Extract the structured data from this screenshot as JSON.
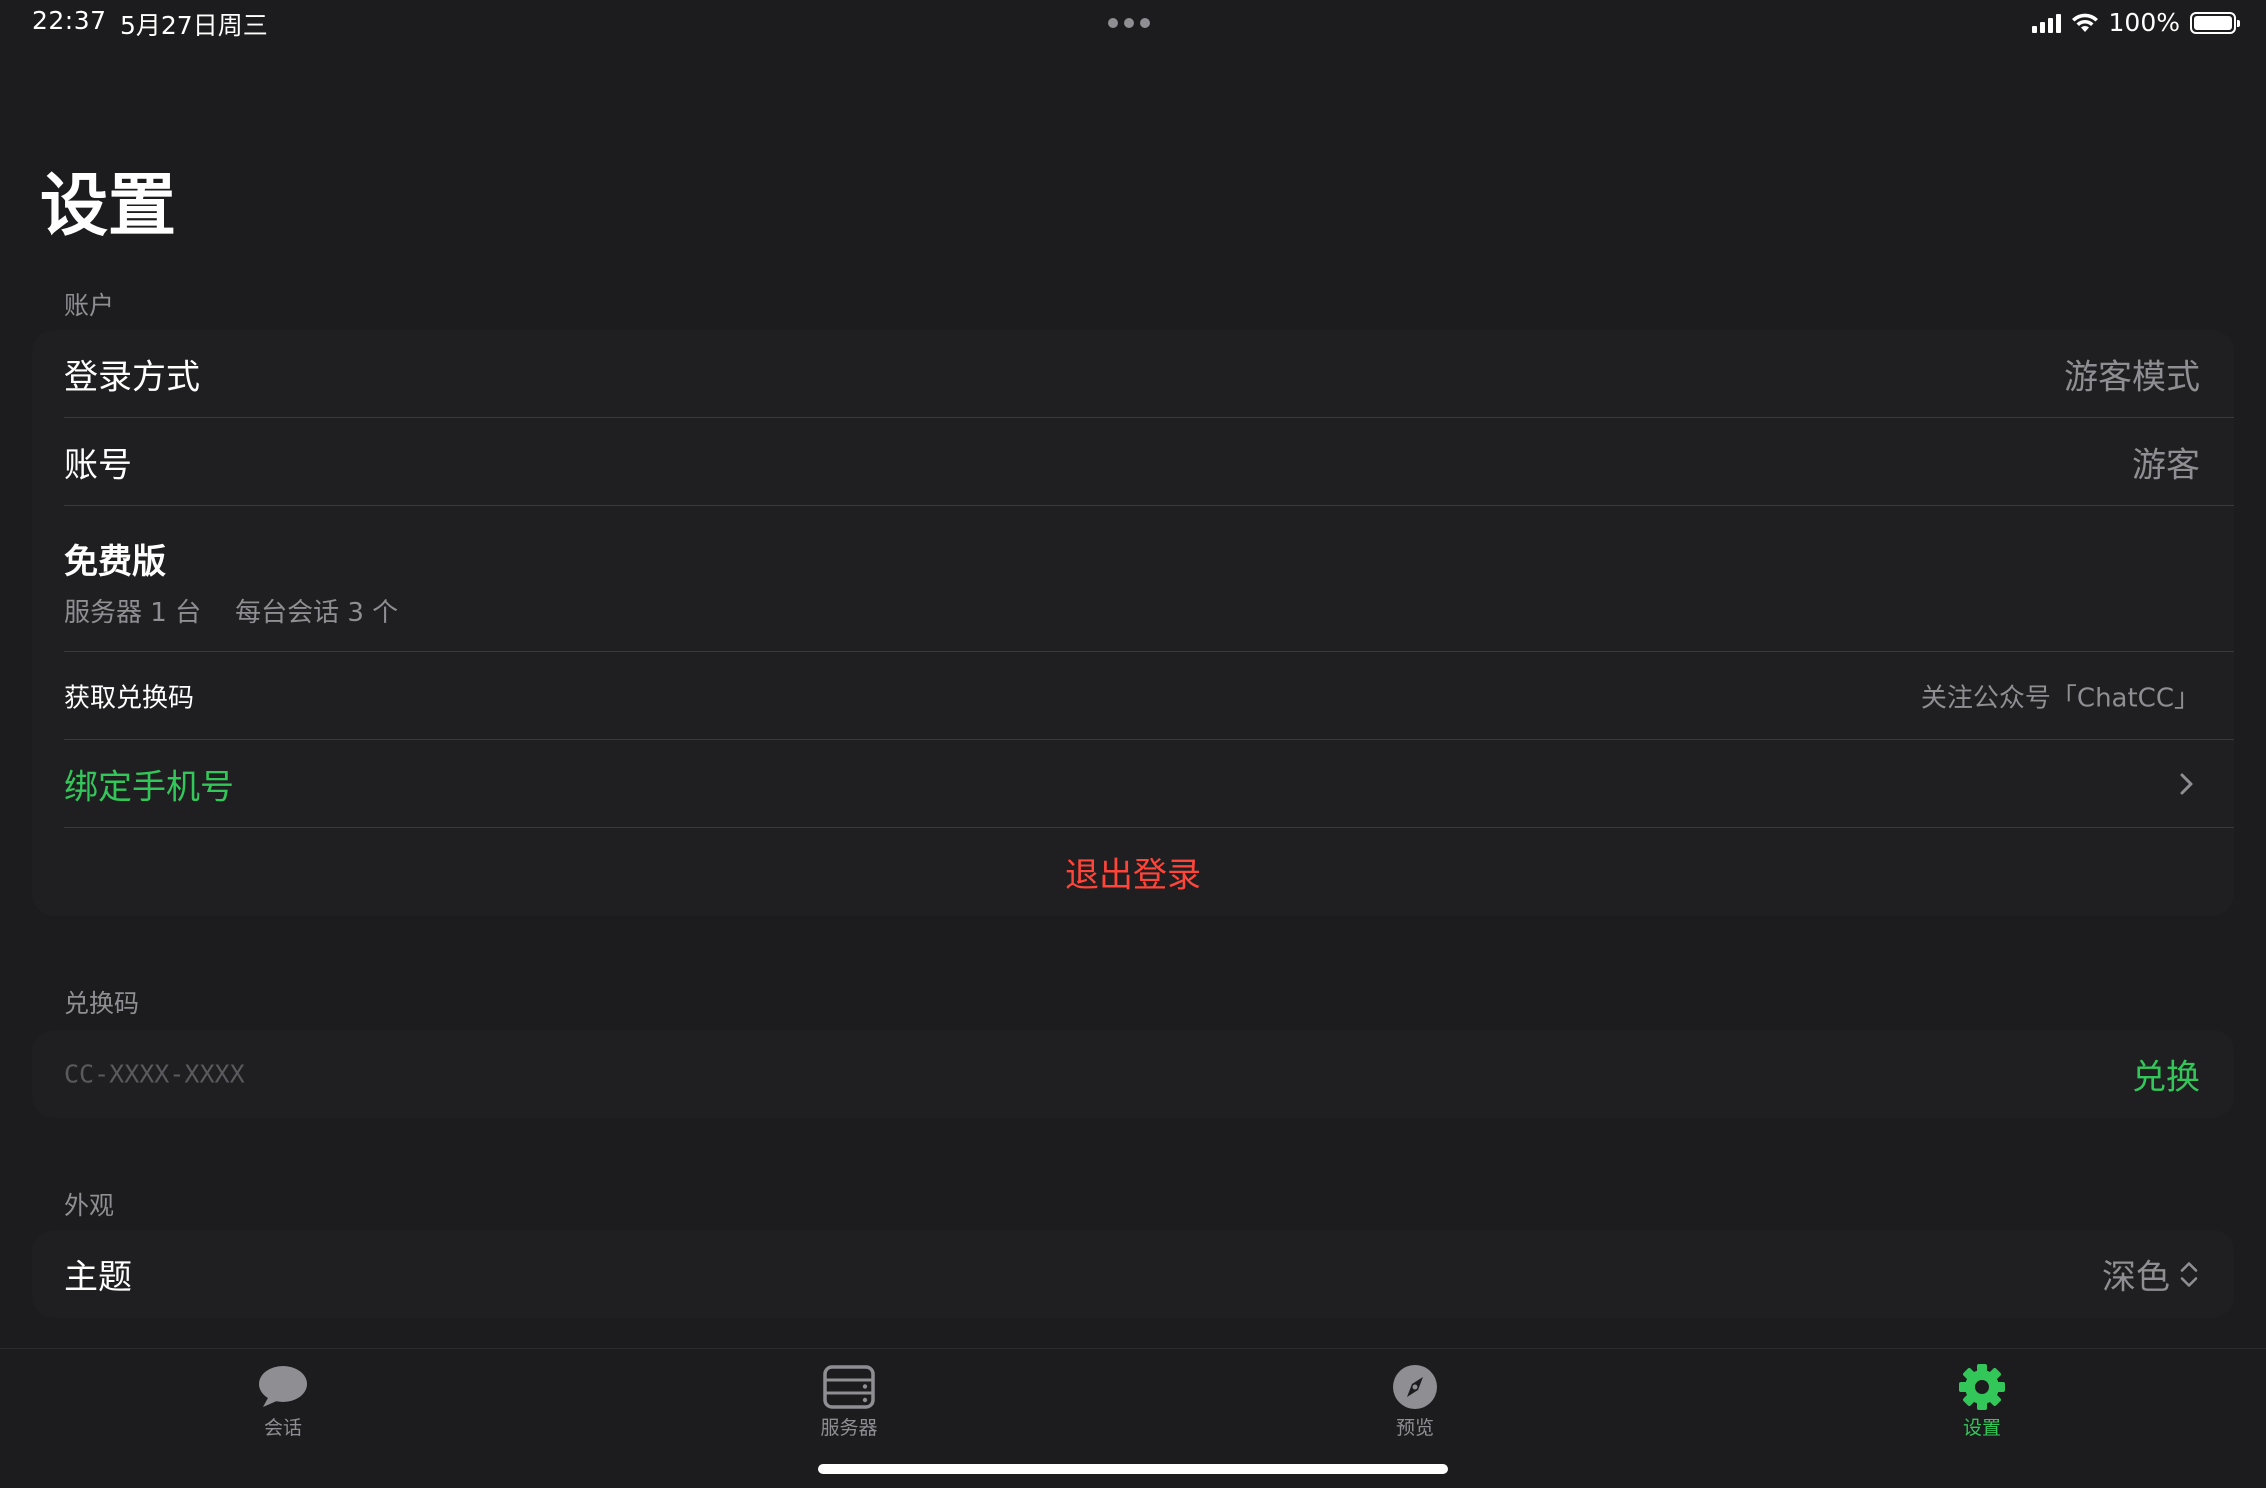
{
  "status_bar": {
    "time": "22:37",
    "date": "5月27日周三",
    "battery_percent": "100%"
  },
  "page": {
    "title": "设置"
  },
  "account": {
    "header": "账户",
    "login_method_label": "登录方式",
    "login_method_value": "游客模式",
    "account_label": "账号",
    "account_value": "游客",
    "plan_title": "免费版",
    "plan_servers": "服务器 1 台",
    "plan_sessions": "每台会话 3 个",
    "get_code_label": "获取兑换码",
    "get_code_value": "关注公众号「ChatCC」",
    "bind_phone_label": "绑定手机号",
    "logout_label": "退出登录"
  },
  "redeem": {
    "header": "兑换码",
    "placeholder": "CC-XXXX-XXXX",
    "button_label": "兑换"
  },
  "appearance": {
    "header": "外观",
    "theme_label": "主题",
    "theme_value": "深色"
  },
  "tabbar": {
    "tabs": [
      {
        "label": "会话",
        "icon": "chat-bubble-icon",
        "active": false
      },
      {
        "label": "服务器",
        "icon": "server-icon",
        "active": false
      },
      {
        "label": "预览",
        "icon": "compass-icon",
        "active": false
      },
      {
        "label": "设置",
        "icon": "gear-icon",
        "active": true
      }
    ]
  },
  "colors": {
    "background": "#1c1c1e",
    "group_background": "#1f1f21",
    "accent_green": "#33c75a",
    "destructive_red": "#ff453a",
    "secondary_text": "#8e8e93"
  }
}
